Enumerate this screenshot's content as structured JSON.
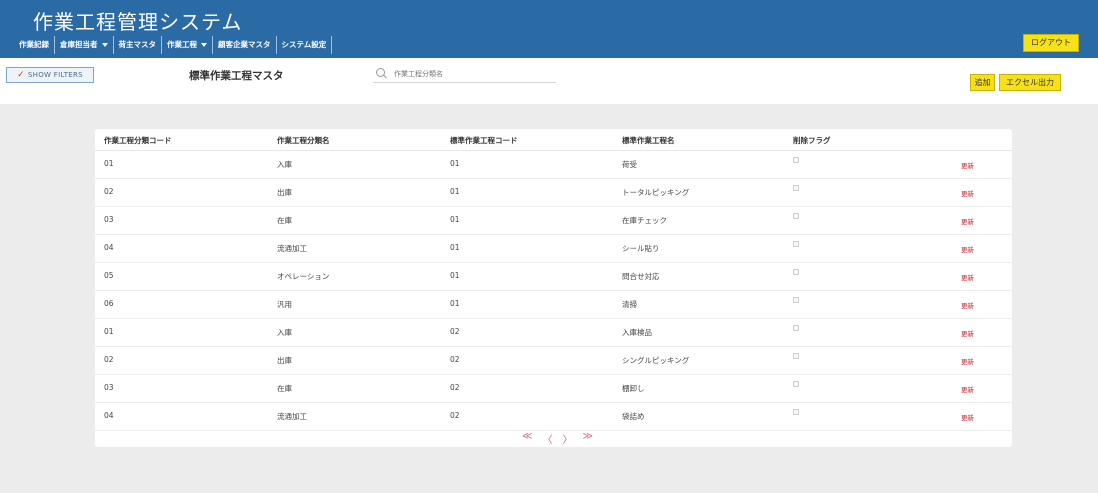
{
  "app": {
    "title": "作業工程管理システム"
  },
  "nav": {
    "items": [
      {
        "label": "作業記録",
        "caret": false
      },
      {
        "label": "倉庫担当者",
        "caret": true
      },
      {
        "label": "荷主マスタ",
        "caret": false
      },
      {
        "label": "作業工程",
        "caret": true
      },
      {
        "label": "顧客企業マスタ",
        "caret": false
      },
      {
        "label": "システム設定",
        "caret": false
      }
    ],
    "logout_label": "ログアウト"
  },
  "toolbar": {
    "filters_label": "SHOW FILTERS",
    "page_title": "標準作業工程マスタ",
    "search_placeholder": "作業工程分類名",
    "add_label": "追加",
    "excel_label": "エクセル出力"
  },
  "table": {
    "headers": [
      "作業工程分類コード",
      "作業工程分類名",
      "標準作業工程コード",
      "標準作業工程名",
      "削除フラグ"
    ],
    "update_label": "更新",
    "rows": [
      [
        "01",
        "入庫",
        "01",
        "荷受"
      ],
      [
        "02",
        "出庫",
        "01",
        "トータルピッキング"
      ],
      [
        "03",
        "在庫",
        "01",
        "在庫チェック"
      ],
      [
        "04",
        "流通加工",
        "01",
        "シール貼り"
      ],
      [
        "05",
        "オペレーション",
        "01",
        "問合せ対応"
      ],
      [
        "06",
        "汎用",
        "01",
        "清掃"
      ],
      [
        "01",
        "入庫",
        "02",
        "入庫検品"
      ],
      [
        "02",
        "出庫",
        "02",
        "シングルピッキング"
      ],
      [
        "03",
        "在庫",
        "02",
        "棚卸し"
      ],
      [
        "04",
        "流通加工",
        "02",
        "袋詰め"
      ]
    ]
  },
  "pager": {
    "first": "≪",
    "prev": "〈",
    "next": "〉",
    "last": "≫"
  },
  "colors": {
    "header_bg": "#2a6aa5",
    "button_yellow": "#f6e01a",
    "link_red": "#c0212b"
  }
}
